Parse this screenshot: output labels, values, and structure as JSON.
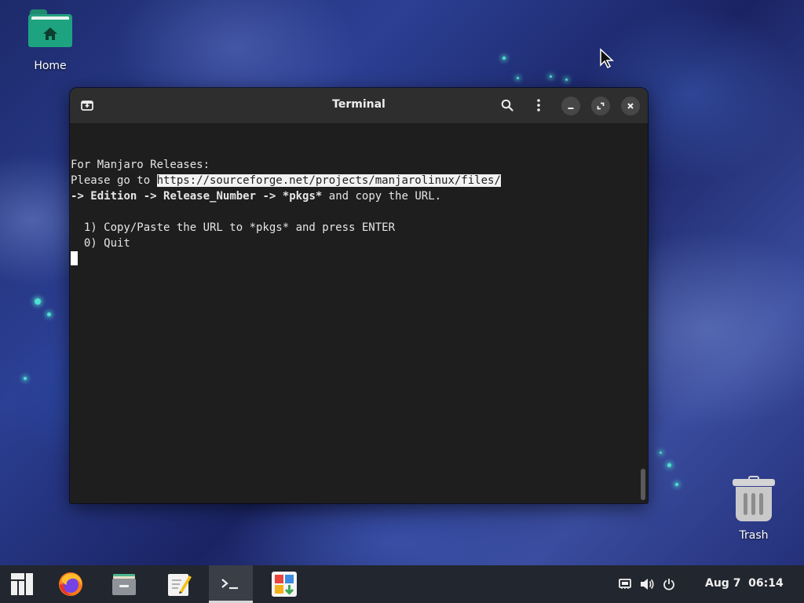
{
  "desktop": {
    "icons": [
      {
        "label": "Home",
        "icon": "folder-home-icon"
      },
      {
        "label": "Trash",
        "icon": "trash-icon"
      }
    ]
  },
  "terminal": {
    "title": "Terminal",
    "lines": {
      "l1": "For Manjaro Releases:",
      "l2_prefix": "Please go to ",
      "l2_url": "https://sourceforge.net/projects/manjarolinux/files/",
      "l3_arrow1": "-> ",
      "l3_edition": "Edition",
      "l3_arrow2": " -> ",
      "l3_release": "Release_Number",
      "l3_arrow3": " -> ",
      "l3_pkgs": "*pkgs*",
      "l3_rest": " and copy the URL.",
      "opt1": "  1) Copy/Paste the URL to *pkgs* and press ENTER",
      "opt0": "  0) Quit"
    },
    "colors": {
      "background": "#1e1e1e",
      "titlebar": "#2e2e2e",
      "text": "#e6e6e6"
    }
  },
  "taskbar": {
    "apps": [
      {
        "name": "Manjaro menu",
        "icon": "manjaro-logo-icon"
      },
      {
        "name": "Firefox",
        "icon": "firefox-icon"
      },
      {
        "name": "Files",
        "icon": "files-icon"
      },
      {
        "name": "Text Editor",
        "icon": "text-editor-icon"
      },
      {
        "name": "Terminal",
        "icon": "terminal-icon",
        "active": true
      },
      {
        "name": "Software",
        "icon": "software-store-icon"
      }
    ],
    "tray": [
      "network-icon",
      "volume-icon",
      "power-icon"
    ],
    "clock": "Aug 7  06:14"
  }
}
